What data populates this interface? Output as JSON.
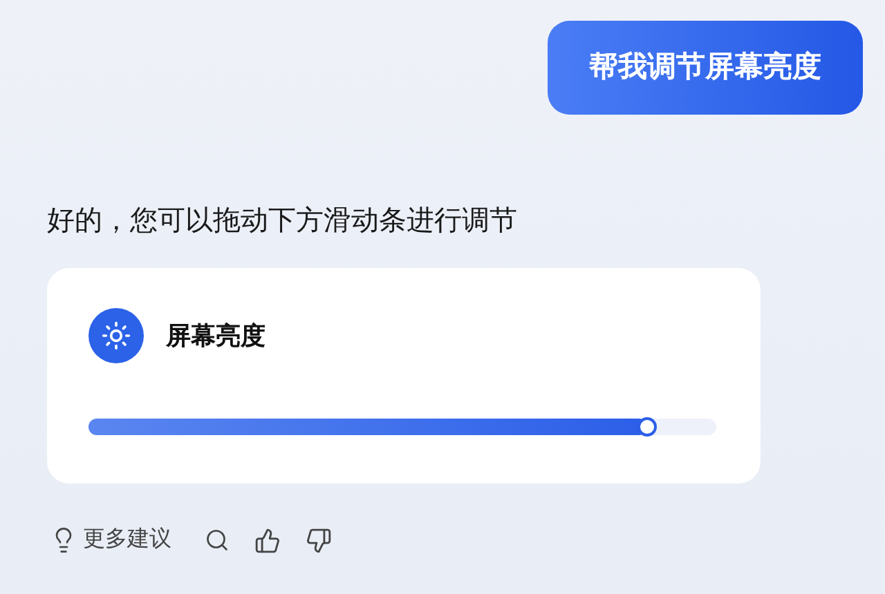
{
  "user_message": {
    "text": "帮我调节屏幕亮度"
  },
  "reply": {
    "text": "好的，您可以拖动下方滑动条进行调节"
  },
  "brightness_card": {
    "title": "屏幕亮度",
    "level": 0.89
  },
  "actions": {
    "suggestions_label": "更多建议"
  }
}
